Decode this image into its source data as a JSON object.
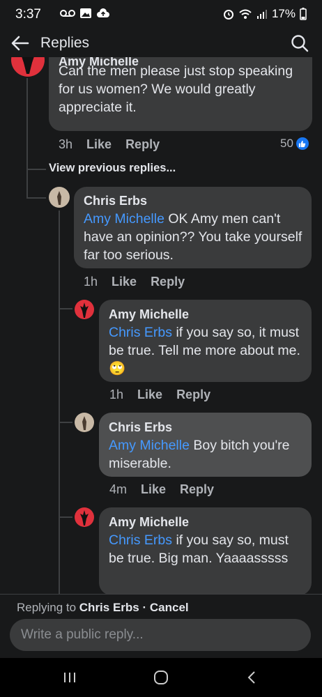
{
  "status_bar": {
    "time": "3:37",
    "battery": "17%"
  },
  "app_bar": {
    "title": "Replies"
  },
  "comments": {
    "top": {
      "author": "Amy Michelle",
      "text": "Can the men please just stop speaking for us women? We would greatly appreciate it.",
      "time": "3h",
      "like": "Like",
      "reply": "Reply",
      "reaction_count": "50"
    },
    "view_previous": "View previous replies...",
    "c1": {
      "author": "Chris Erbs",
      "mention": "Amy Michelle",
      "text": " OK Amy men can't have an opinion?? You take yourself far too serious.",
      "time": "1h",
      "like": "Like",
      "reply": "Reply"
    },
    "c2": {
      "author": "Amy Michelle",
      "mention": "Chris Erbs",
      "text": " if you say so, it must be true. Tell me more about me. ",
      "emoji": "🙄",
      "time": "1h",
      "like": "Like",
      "reply": "Reply"
    },
    "c3": {
      "author": "Chris Erbs",
      "mention": "Amy Michelle",
      "text": " Boy bitch you're miserable.",
      "time": "4m",
      "like": "Like",
      "reply": "Reply"
    },
    "c4": {
      "author": "Amy Michelle",
      "mention": "Chris Erbs",
      "text": " if you say so, must be true. Big man. Yaaaasssss"
    }
  },
  "footer": {
    "replying_prefix": "Replying to ",
    "replying_name": "Chris Erbs",
    "cancel": " · Cancel",
    "input_placeholder": "Write a public reply..."
  },
  "colors": {
    "background": "#18191a",
    "bubble": "#3a3b3c",
    "mention": "#4599ff",
    "like_blue": "#1877f2"
  }
}
